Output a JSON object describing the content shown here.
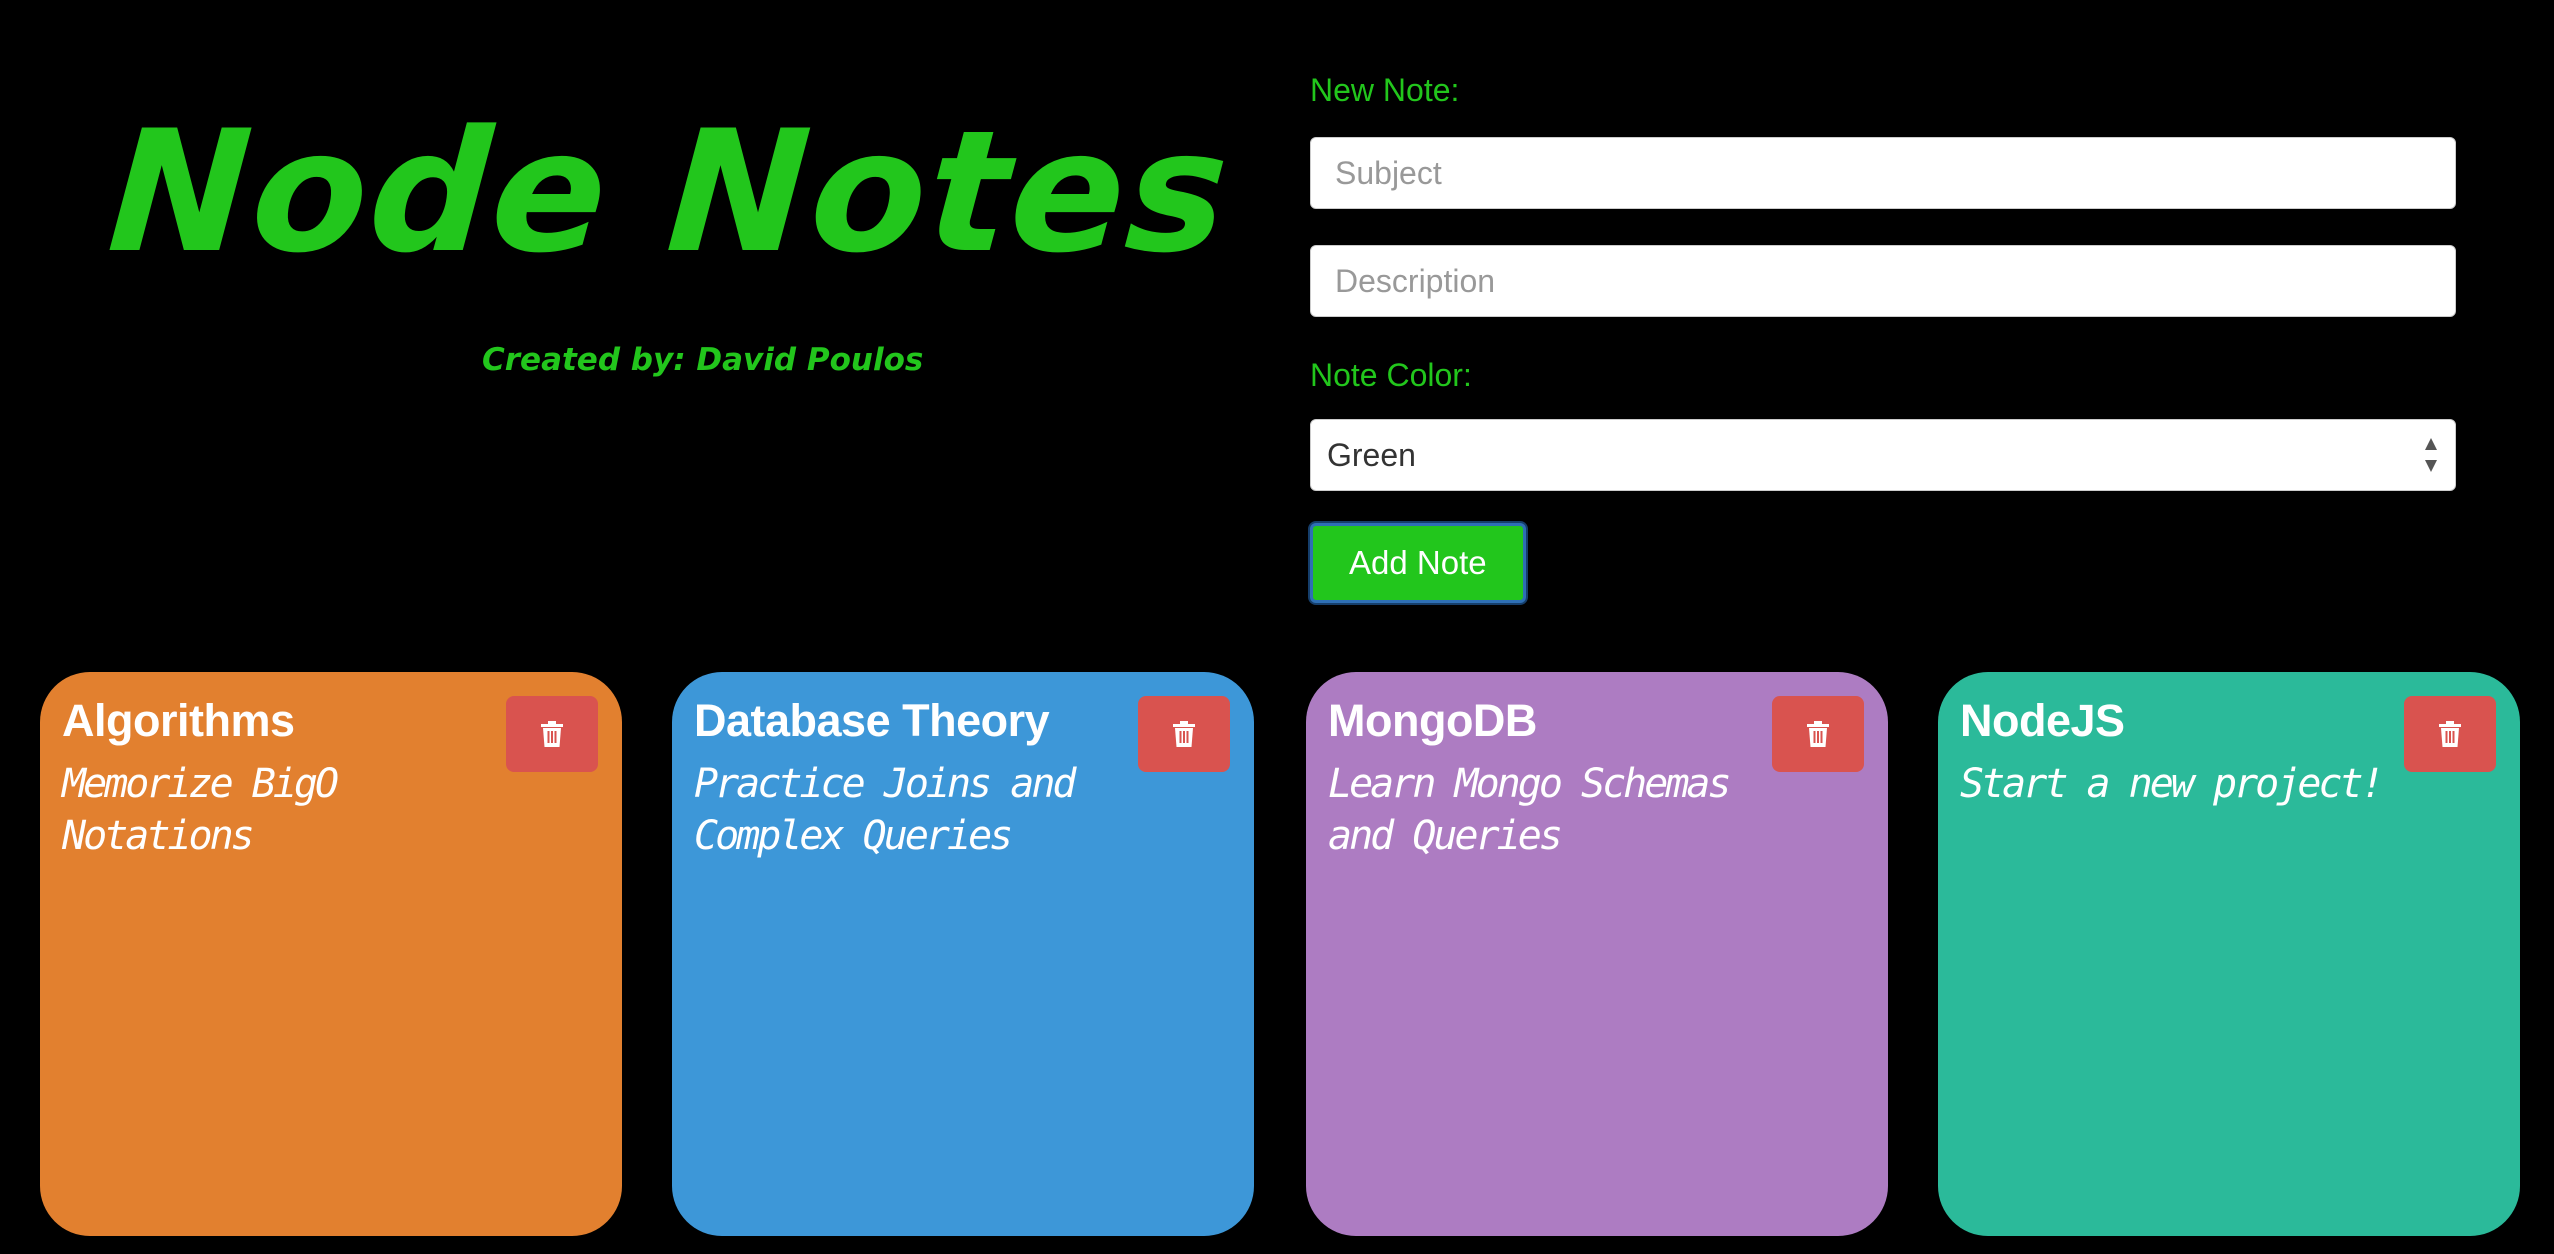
{
  "header": {
    "title": "Node Notes",
    "credit": "Created by: David Poulos"
  },
  "form": {
    "new_note_label": "New Note:",
    "subject_placeholder": "Subject",
    "subject_value": "",
    "description_placeholder": "Description",
    "description_value": "",
    "color_label": "Note Color:",
    "color_selected": "Green",
    "add_button_label": "Add Note",
    "accent_color": "#22c61c"
  },
  "notes": [
    {
      "subject": "Algorithms",
      "description": "Memorize BigO Notations",
      "color": "#e2802f",
      "delete_icon": "trash-icon"
    },
    {
      "subject": "Database Theory",
      "description": "Practice Joins and Complex Queries",
      "color": "#3d97d8",
      "delete_icon": "trash-icon"
    },
    {
      "subject": "MongoDB",
      "description": "Learn Mongo Schemas and Queries",
      "color": "#ad7cc2",
      "delete_icon": "trash-icon"
    },
    {
      "subject": "NodeJS",
      "description": "Start a new project!",
      "color": "#2bba9a",
      "delete_icon": "trash-icon"
    }
  ],
  "colors": {
    "background": "#000000",
    "delete_button": "#d9534f"
  }
}
